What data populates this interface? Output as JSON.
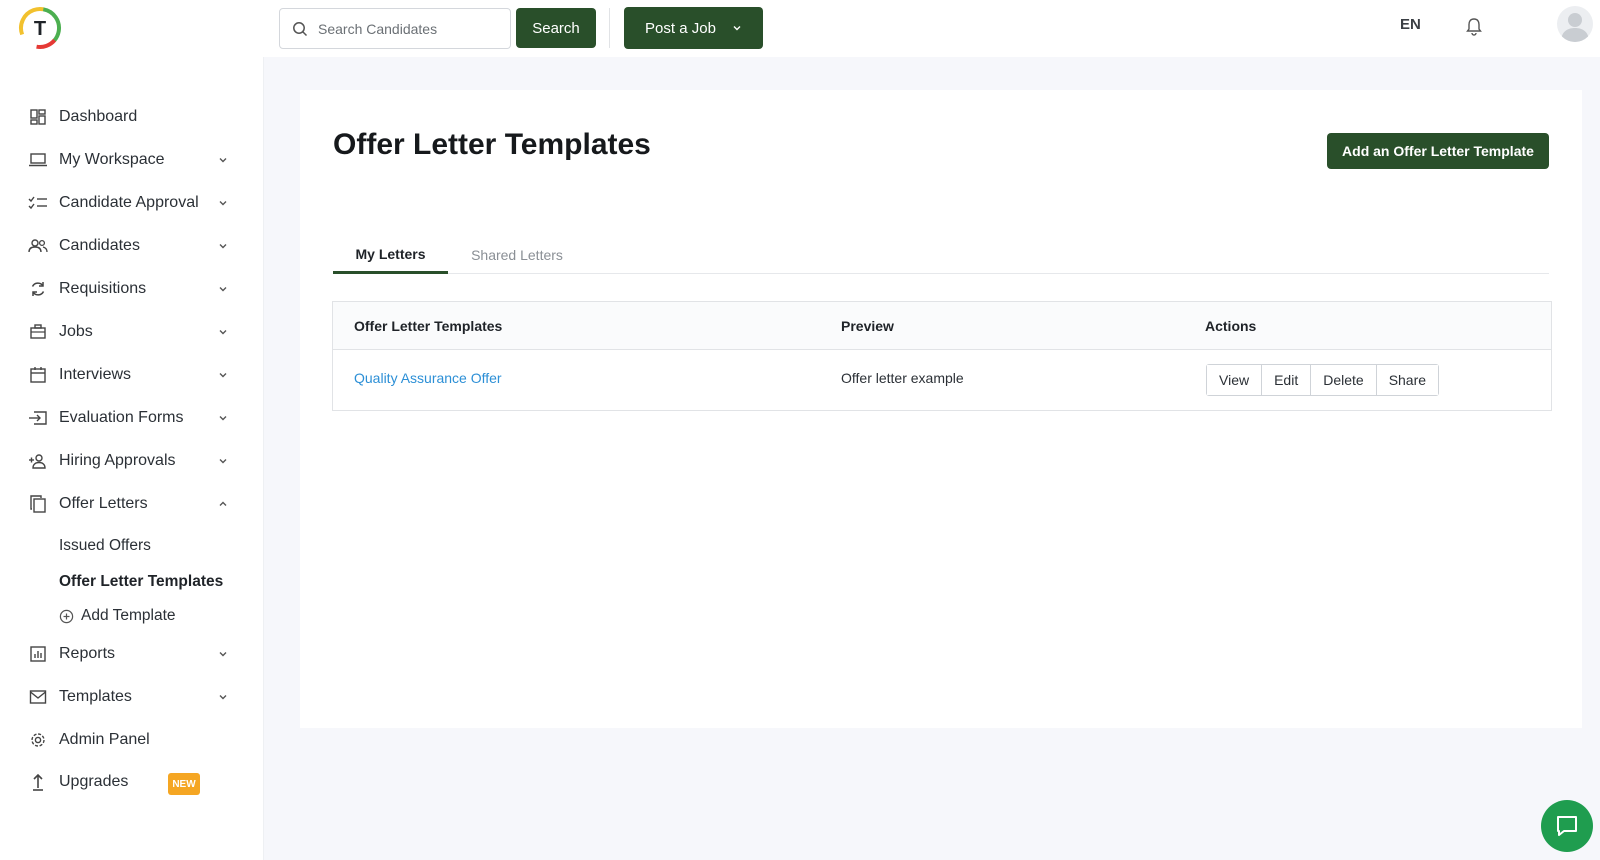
{
  "header": {
    "logo_letter": "T",
    "search_placeholder": "Search Candidates",
    "search_label": "Search",
    "post_job_label": "Post a Job",
    "language": "EN"
  },
  "sidebar": {
    "items": [
      {
        "label": "Dashboard",
        "icon": "dashboard-icon"
      },
      {
        "label": "My Workspace",
        "icon": "laptop-icon"
      },
      {
        "label": "Candidate Approval",
        "icon": "checklist-icon"
      },
      {
        "label": "Candidates",
        "icon": "people-icon"
      },
      {
        "label": "Requisitions",
        "icon": "refresh-icon"
      },
      {
        "label": "Jobs",
        "icon": "briefcase-icon"
      },
      {
        "label": "Interviews",
        "icon": "calendar-icon"
      },
      {
        "label": "Evaluation Forms",
        "icon": "form-icon"
      },
      {
        "label": "Hiring Approvals",
        "icon": "add-person-icon"
      },
      {
        "label": "Offer Letters",
        "icon": "copy-icon"
      },
      {
        "label": "Reports",
        "icon": "report-icon"
      },
      {
        "label": "Templates",
        "icon": "mail-icon"
      },
      {
        "label": "Admin Panel",
        "icon": "gear-icon"
      },
      {
        "label": "Upgrades",
        "icon": "upload-icon"
      }
    ],
    "offer_sub": {
      "issued": "Issued Offers",
      "templates": "Offer Letter Templates",
      "add": "Add Template"
    },
    "new_badge": "NEW"
  },
  "main": {
    "title": "Offer Letter Templates",
    "add_button": "Add an Offer Letter Template",
    "tabs": [
      {
        "label": "My Letters",
        "active": true
      },
      {
        "label": "Shared Letters",
        "active": false
      }
    ],
    "table": {
      "headers": [
        "Offer Letter Templates",
        "Preview",
        "Actions"
      ],
      "rows": [
        {
          "name": "Quality Assurance Offer",
          "preview": "Offer letter example"
        }
      ],
      "actions": [
        "View",
        "Edit",
        "Delete",
        "Share"
      ]
    }
  },
  "colors": {
    "primary": "#294f2a",
    "link": "#2c8fd6",
    "badge": "#f5a623",
    "chat": "#1f9d4f"
  }
}
